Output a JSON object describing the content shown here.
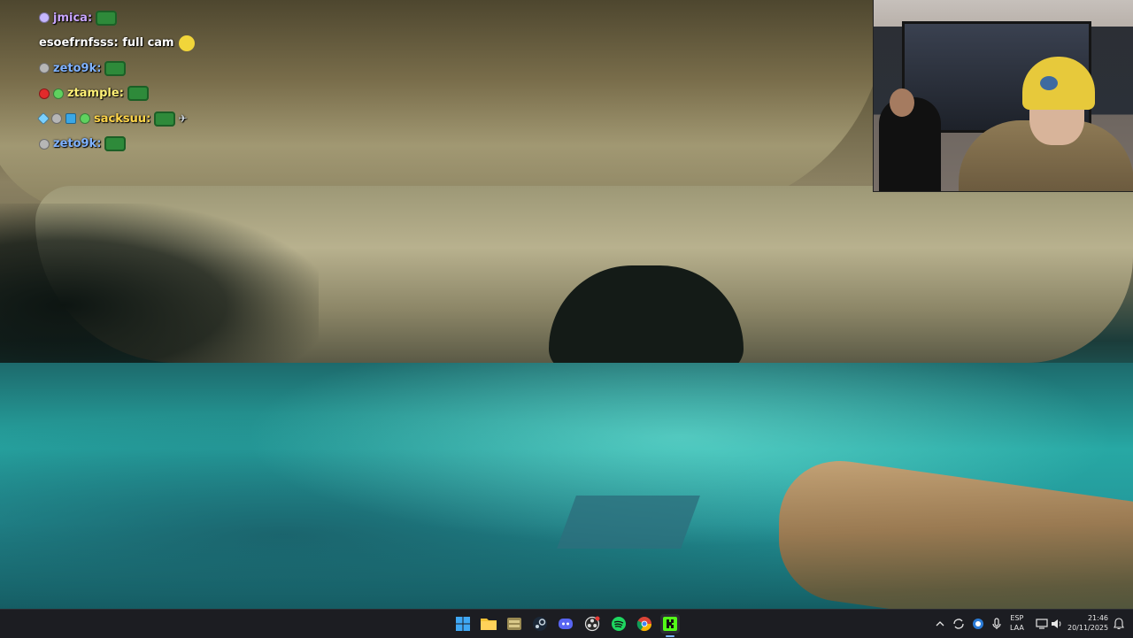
{
  "chat": [
    {
      "badges": [
        "purple"
      ],
      "user": "jmica",
      "user_color": "#c9a6ff",
      "sep": ":",
      "message": "",
      "emote": "green"
    },
    {
      "badges": [],
      "user": "esoefrnfsss",
      "user_color": "#ffffff",
      "sep": ":",
      "message": " full cam",
      "emote": "yellow"
    },
    {
      "badges": [
        "gray"
      ],
      "user": "zeto9k",
      "user_color": "#7fb2ff",
      "sep": ":",
      "message": "",
      "emote": "green"
    },
    {
      "badges": [
        "red",
        "green"
      ],
      "user": "ztample",
      "user_color": "#fff176",
      "sep": ":",
      "message": "",
      "emote": "green"
    },
    {
      "badges": [
        "sword",
        "gray",
        "blue",
        "green"
      ],
      "user": "sacksuu",
      "user_color": "#ffd54a",
      "sep": ":",
      "message": "",
      "emote": "green-spin"
    },
    {
      "badges": [
        "gray"
      ],
      "user": "zeto9k",
      "user_color": "#7fb2ff",
      "sep": ":",
      "message": "",
      "emote": "green"
    }
  ],
  "taskbar": {
    "apps": [
      "start-icon",
      "file-explorer-icon",
      "archive-app-icon",
      "steam-icon",
      "discord-icon",
      "obs-icon",
      "spotify-icon",
      "chrome-icon",
      "kick-icon"
    ],
    "lang_line1": "ESP",
    "lang_line2": "LAA",
    "time": "21:46",
    "date": "20/11/2025"
  },
  "colors": {
    "taskbar_bg": "#1c1d22",
    "water": "#27a8a4"
  }
}
